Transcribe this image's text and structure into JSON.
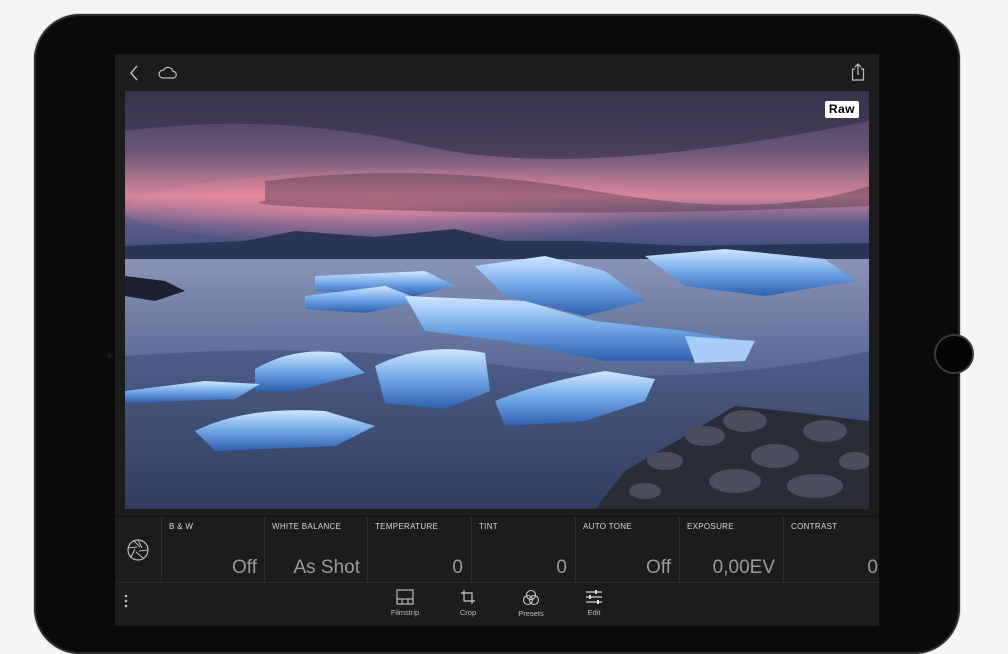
{
  "topbar": {
    "back_icon": "chevron-left-icon",
    "cloud_icon": "cloud-icon",
    "share_icon": "share-icon"
  },
  "photo": {
    "badge": "Raw"
  },
  "adjustments": {
    "lens_icon": "aperture-icon",
    "items": [
      {
        "label": "B & W",
        "value": "Off"
      },
      {
        "label": "WHITE BALANCE",
        "value": "As Shot"
      },
      {
        "label": "TEMPERATURE",
        "value": "0"
      },
      {
        "label": "TINT",
        "value": "0"
      },
      {
        "label": "AUTO TONE",
        "value": "Off"
      },
      {
        "label": "EXPOSURE",
        "value": "0,00EV"
      },
      {
        "label": "CONTRAST",
        "value": "0"
      }
    ]
  },
  "toolbar": {
    "more_icon": "more-vertical-icon",
    "tools": [
      {
        "label": "Filmstrip",
        "icon": "filmstrip-icon"
      },
      {
        "label": "Crop",
        "icon": "crop-icon"
      },
      {
        "label": "Presets",
        "icon": "presets-icon"
      },
      {
        "label": "Edit",
        "icon": "sliders-icon"
      }
    ]
  }
}
